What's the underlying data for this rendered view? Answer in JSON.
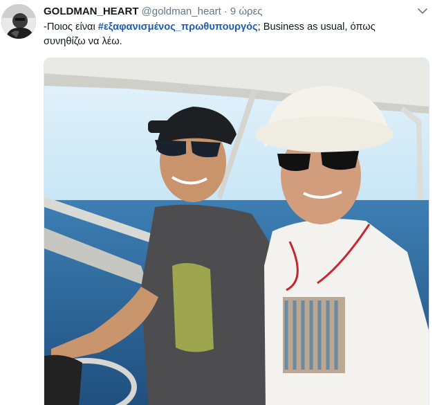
{
  "tweet": {
    "display_name": "GOLDMAN_HEART",
    "handle": "@goldman_heart",
    "separator": "·",
    "timestamp": "9 ώρες",
    "text_before": "-Ποιος είναι ",
    "hashtag": "#εξαφανισμένος_πρωθυπουργός",
    "text_after": "; Business as usual, όπως συνηθίζω να λέω.",
    "avatar_icon": "profile-avatar",
    "menu_icon": "chevron-down-icon"
  },
  "colors": {
    "link": "#1b5db5",
    "secondary_text": "#657786",
    "primary_text": "#14171a"
  }
}
